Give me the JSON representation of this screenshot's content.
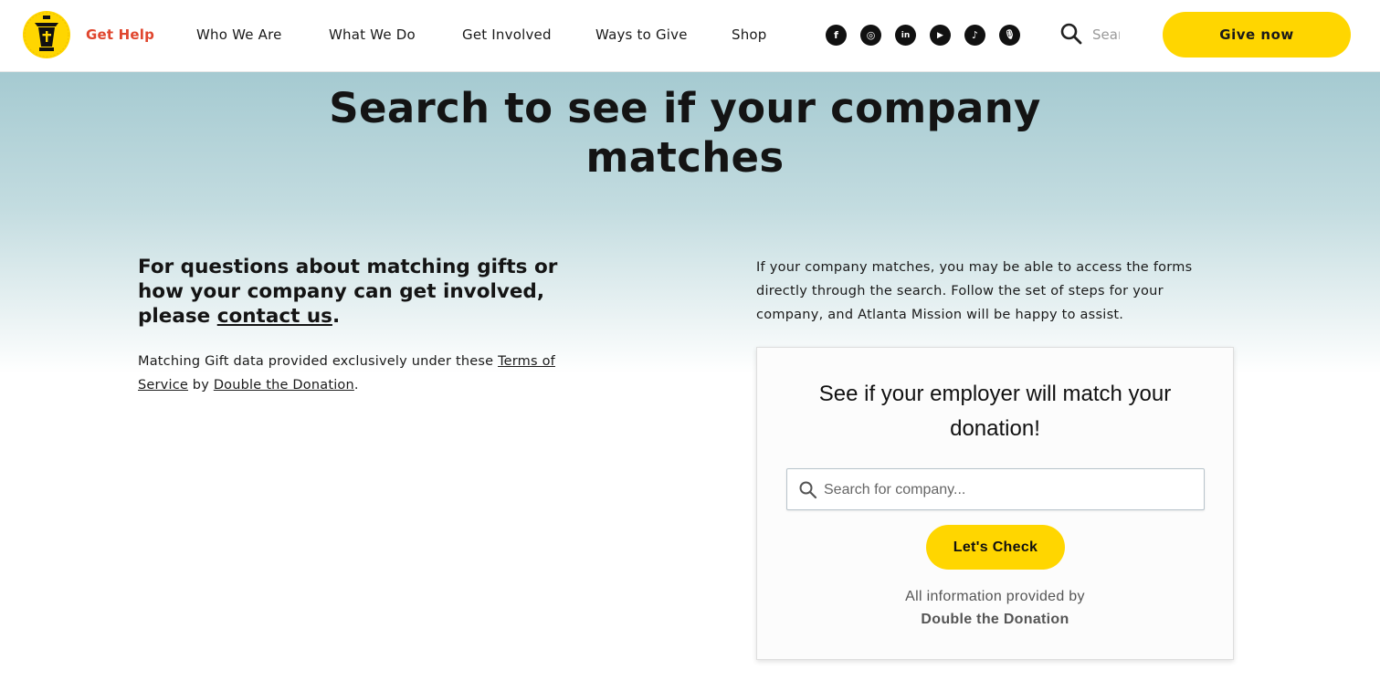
{
  "header": {
    "nav": [
      {
        "label": "Get Help",
        "active": true
      },
      {
        "label": "Who We Are",
        "active": false
      },
      {
        "label": "What We Do",
        "active": false
      },
      {
        "label": "Get Involved",
        "active": false
      },
      {
        "label": "Ways to Give",
        "active": false
      },
      {
        "label": "Shop",
        "active": false
      }
    ],
    "socials": [
      "facebook-icon",
      "instagram-icon",
      "linkedin-icon",
      "youtube-icon",
      "tiktok-icon",
      "podcast-icon"
    ],
    "social_glyphs": [
      "f",
      "◎",
      "in",
      "▶",
      "♪",
      "🎙"
    ],
    "search_placeholder": "Search",
    "give_now_label": "Give now"
  },
  "hero": {
    "title_line1": "Search to see if your company",
    "title_line2": "matches"
  },
  "left": {
    "heading_prefix": "For questions about matching gifts or how your company can get involved, please ",
    "heading_link": "contact us",
    "heading_suffix": ".",
    "note_prefix": "Matching Gift data provided exclusively under these ",
    "note_link1": "Terms of Service",
    "note_mid": " by ",
    "note_link2": "Double the Donation",
    "note_suffix": "."
  },
  "right": {
    "intro": "If your company matches, you may be able to access the forms directly through the search. Follow the set of steps for your company, and Atlanta Mission will be happy to assist."
  },
  "widget": {
    "title": "See if your employer will match your donation!",
    "search_placeholder": "Search for company...",
    "button_label": "Let's Check",
    "powered_line1": "All information provided by",
    "powered_line2": "Double the Donation"
  },
  "colors": {
    "accent_yellow": "#ffd600",
    "active_nav": "#e0462e",
    "hero_top": "#a5cad1"
  }
}
